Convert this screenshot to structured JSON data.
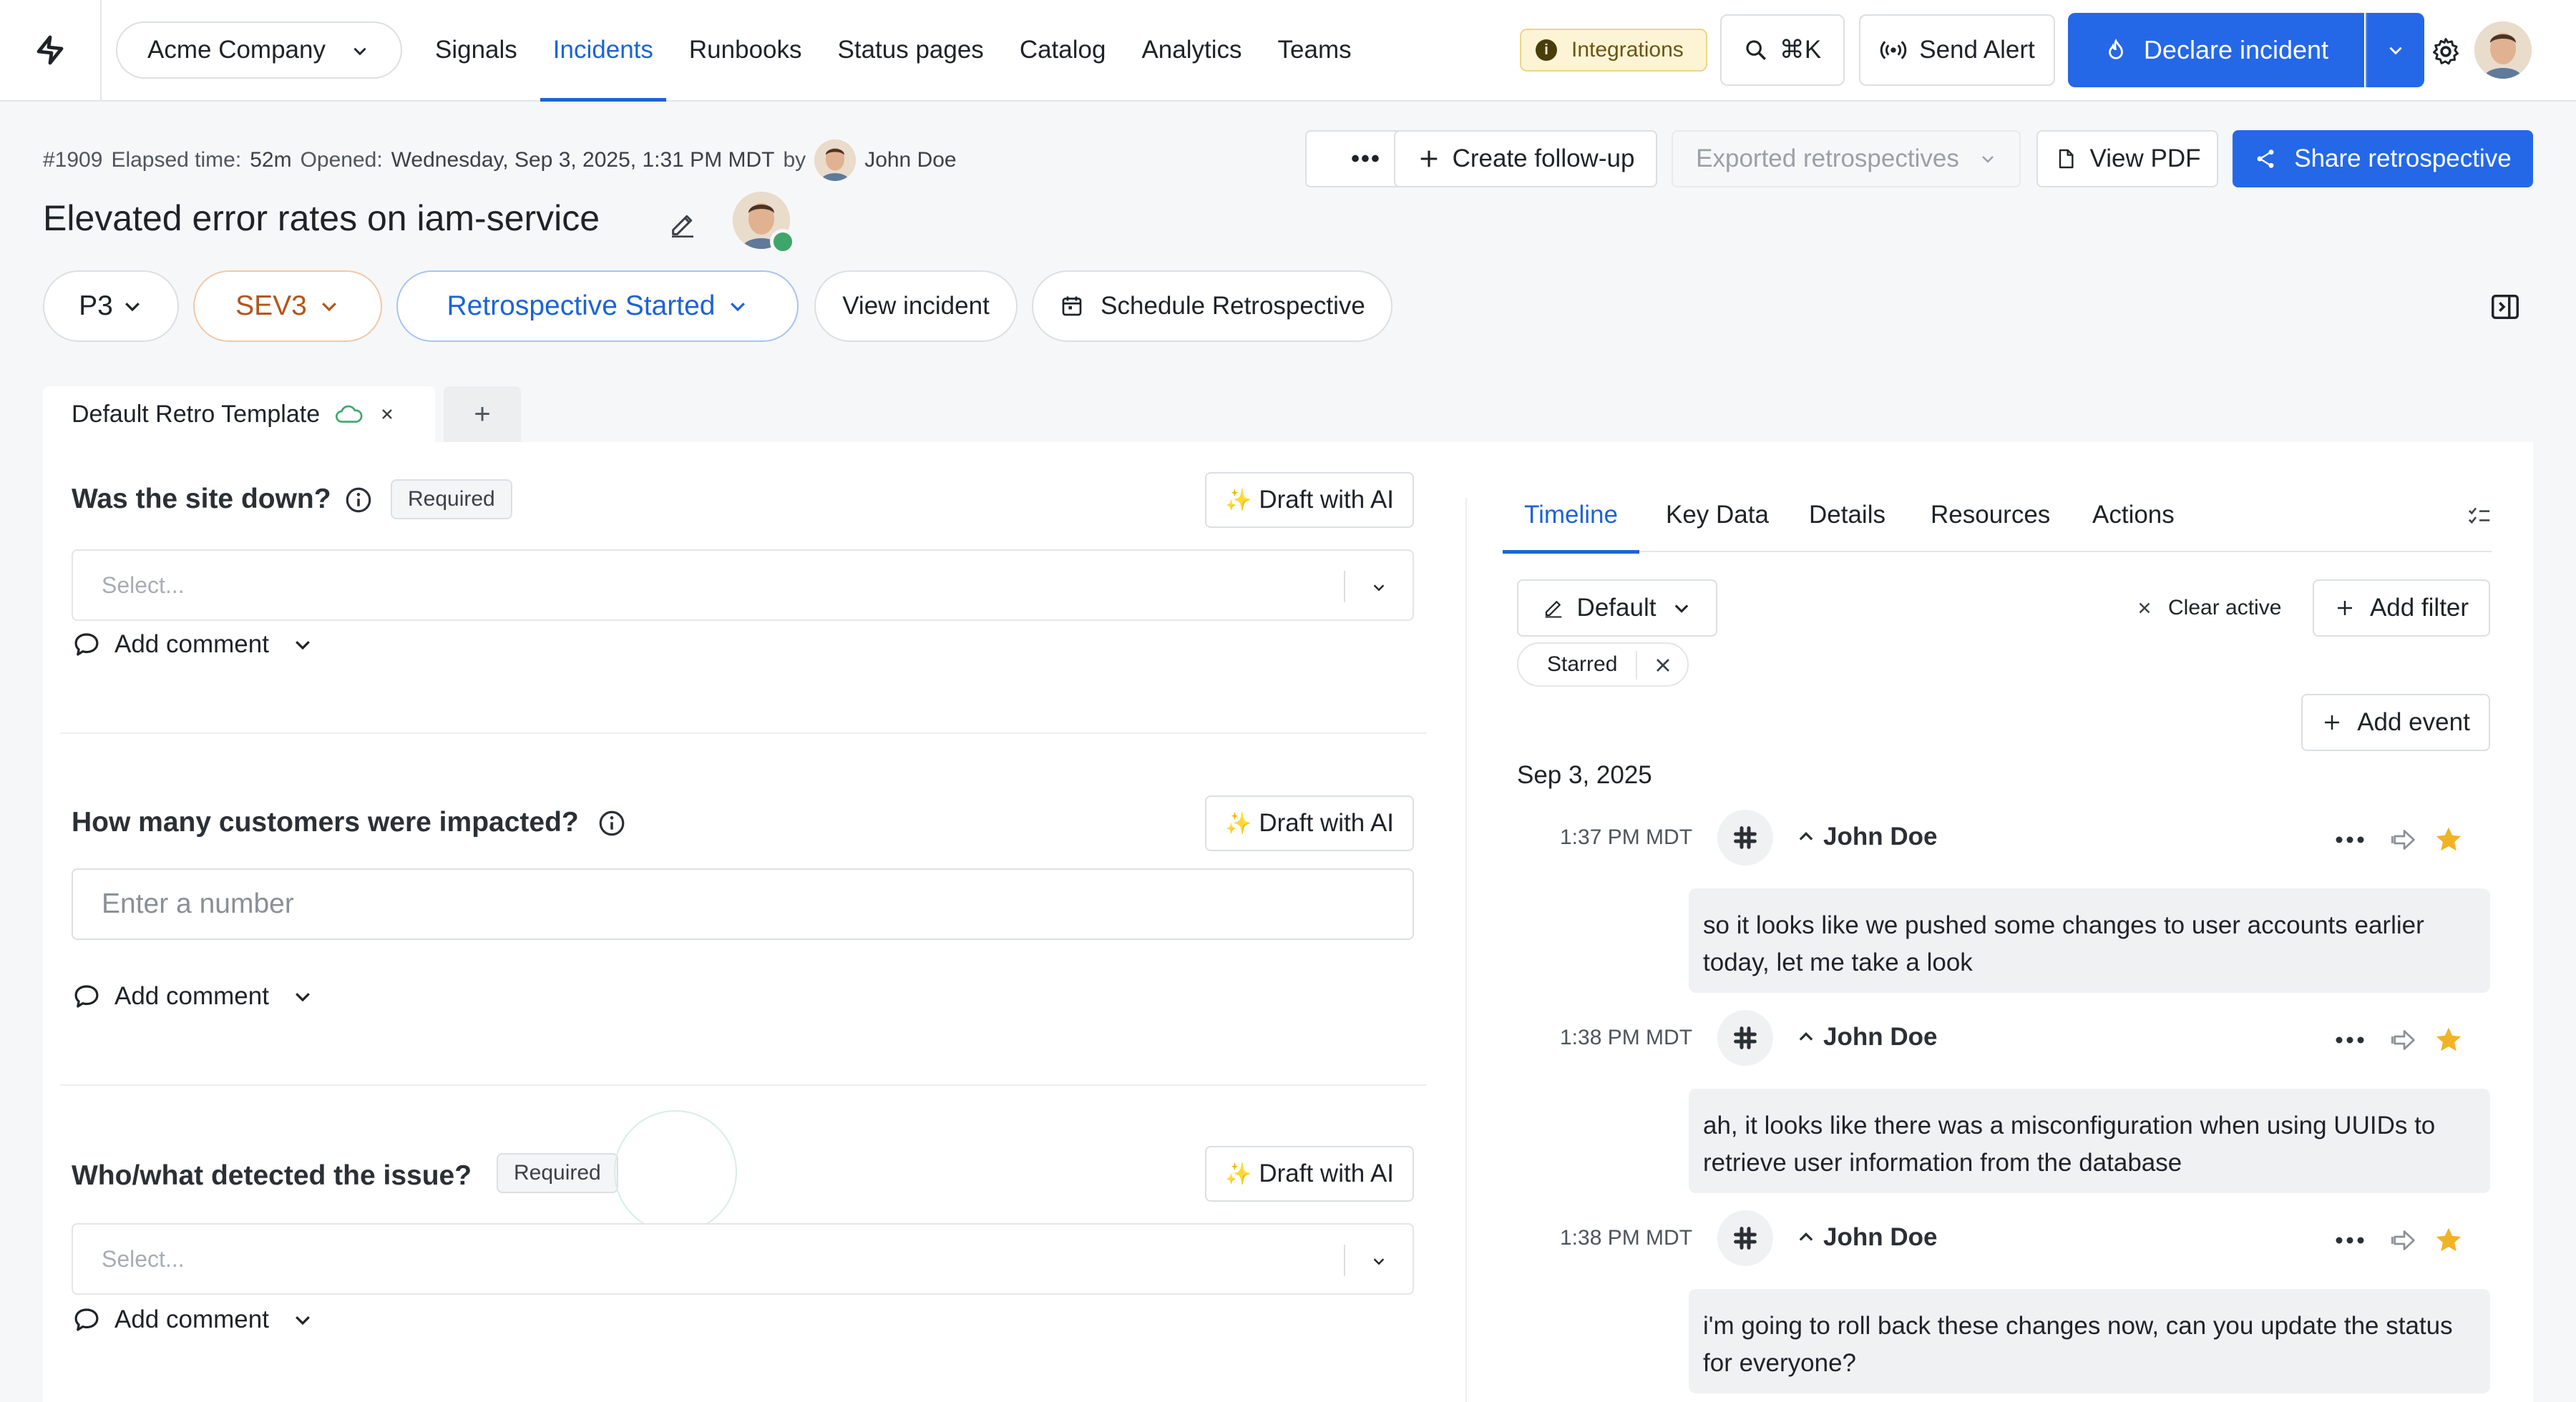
{
  "org": {
    "name": "Acme Company"
  },
  "nav": {
    "items": [
      {
        "label": "Signals",
        "active": false
      },
      {
        "label": "Incidents",
        "active": true
      },
      {
        "label": "Runbooks",
        "active": false
      },
      {
        "label": "Status pages",
        "active": false
      },
      {
        "label": "Catalog",
        "active": false
      },
      {
        "label": "Analytics",
        "active": false
      },
      {
        "label": "Teams",
        "active": false
      }
    ],
    "integrations_label": "Integrations",
    "search_shortcut": "⌘K",
    "send_alert_label": "Send Alert",
    "declare_label": "Declare incident"
  },
  "incident": {
    "id": "#1909",
    "elapsed_label": "Elapsed time:",
    "elapsed_value": "52m",
    "opened_label": "Opened:",
    "opened_value": "Wednesday, Sep 3, 2025, 1:31 PM MDT",
    "by_label": "by",
    "owner": "John Doe",
    "title": "Elevated error rates on iam-service",
    "priority": "P3",
    "severity": "SEV3",
    "status": "Retrospective Started"
  },
  "header_actions": {
    "more": "•••",
    "create_follow_up": "Create follow-up",
    "exported_retros": "Exported retrospectives",
    "view_pdf": "View PDF",
    "share": "Share retrospective",
    "view_incident": "View incident",
    "schedule_retro": "Schedule Retrospective"
  },
  "retro_tab": {
    "label": "Default Retro Template",
    "add": "+"
  },
  "form": {
    "draft_label": "Draft with AI",
    "add_comment_label": "Add comment",
    "required_label": "Required",
    "questions": [
      {
        "label": "Was the site down?",
        "placeholder": "Select..."
      },
      {
        "label": "How many customers were impacted?",
        "placeholder": "Enter a number"
      },
      {
        "label": "Who/what detected the issue?",
        "placeholder": "Select..."
      }
    ]
  },
  "right_panel": {
    "tabs": [
      {
        "label": "Timeline",
        "active": true
      },
      {
        "label": "Key Data",
        "active": false
      },
      {
        "label": "Details",
        "active": false
      },
      {
        "label": "Resources",
        "active": false
      },
      {
        "label": "Actions",
        "active": false
      }
    ],
    "view_select": "Default",
    "clear_active": "Clear active",
    "add_filter": "Add filter",
    "starred_chip": "Starred",
    "add_event": "Add event",
    "date_header": "Sep 3, 2025",
    "events": [
      {
        "time": "1:37 PM MDT",
        "author": "John Doe",
        "text": "so it looks like we pushed some changes to user accounts earlier today, let me take a look"
      },
      {
        "time": "1:38 PM MDT",
        "author": "John Doe",
        "text": "ah, it looks like there was a misconfiguration when using UUIDs to retrieve user information from the database"
      },
      {
        "time": "1:38 PM MDT",
        "author": "John Doe",
        "text": "i'm going to roll back these changes now, can you update the status for everyone?"
      }
    ]
  },
  "colors": {
    "accent": "#2468e8",
    "severity_text": "#b4551b",
    "status_text": "#1d63d6",
    "star": "#f1b323",
    "online": "#3ea66a"
  }
}
